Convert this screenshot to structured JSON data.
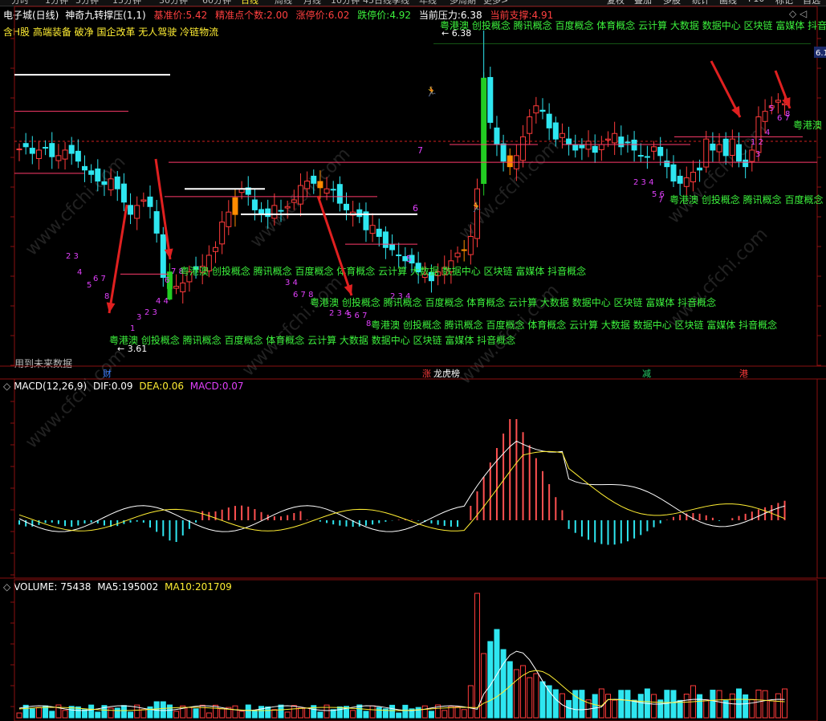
{
  "top_tabs": [
    "分时",
    "1分钟",
    "5分钟",
    "15分钟",
    "30分钟",
    "60分钟",
    "日线",
    "周线",
    "月线",
    "10分钟",
    "45日线",
    "季线",
    "年线",
    "多周期",
    "更多>"
  ],
  "top_buttons": [
    "复权",
    "叠加",
    "多股",
    "统计",
    "画线",
    "F10",
    "标记",
    "自选"
  ],
  "header": {
    "stock": "电子城(日线)",
    "indicator": "神奇九转撑压(1,1)",
    "base_label": "基准价:",
    "base_value": "5.42",
    "count_label": "精准点个数:",
    "count_value": "2.00",
    "limit_up_label": "涨停价:",
    "limit_up_value": "6.02",
    "limit_down_label": "跌停价:",
    "limit_down_value": "4.92",
    "pressure_label": "当前压力:",
    "pressure_value": "6.38",
    "support_label": "当前支撑:",
    "support_value": "4.91"
  },
  "concepts_line": "含H股 高端装备 破净 国企改革 无人驾驶 冷链物流",
  "price_labels": {
    "high": "6.38",
    "low": "3.61",
    "right_tag": "6.1"
  },
  "future_note": "用到未来数据",
  "concept_tags": [
    "粤港澳 创投概念 腾讯概念 百度概念 体育概念 云计算 大数据 数据中心 区块链 富媒体 抖音概念",
    "粤港澳 创投概念 腾讯概念 百度概念 体育概念 云计算 大数据 数据中心 区块链 富媒体 抖音概念",
    "粤港澳 创投概念 腾讯概念 百度概念 体育概念 云计算 大数据 数据中心 区块链 富媒体 抖音概念",
    "粤港澳 创投概念 腾讯概念 百度概念 体育概念 云计算 大数据 数据中心 区块链 富媒体 抖音概念",
    "粤港澳 创投概念 腾讯概念 百度概念 体育概念 云计算 大数据 数据中心 区块链 富媒体 抖音概念",
    "粤港澳 创投概念 腾讯概念 百度概念 体育概念 云计算 大数据 数据中心 区块链 富媒体 抖音概念",
    "粤港澳"
  ],
  "event_markers": [
    {
      "text": "财",
      "color": "#3b7bff"
    },
    {
      "text": "涨",
      "color": "#ff3b3b"
    },
    {
      "text": "龙虎榜",
      "color": "#ffffff"
    },
    {
      "text": "减",
      "color": "#28d26b"
    },
    {
      "text": "港",
      "color": "#ff3b3b"
    }
  ],
  "macd": {
    "title": "MACD(12,26,9)",
    "dif_label": "DIF:",
    "dif": "0.09",
    "dea_label": "DEA:",
    "dea": "0.06",
    "macd_label": "MACD:",
    "macd": "0.07"
  },
  "volume": {
    "title": "VOLUME:",
    "value": "75438",
    "ma5_label": "MA5:",
    "ma5": "195002",
    "ma10_label": "MA10:",
    "ma10": "201709"
  },
  "watermark": "www.cfchi.com",
  "colors": {
    "up": "#ff3b3b",
    "down": "#2ee6f0",
    "limit_up_bar": "#22cc22",
    "limit_down_bar": "#ff8c00",
    "ma_white": "#ffffff",
    "ma_yellow": "#ffee33",
    "magenta": "#e040fb",
    "concept_green": "#3cf03c"
  }
}
